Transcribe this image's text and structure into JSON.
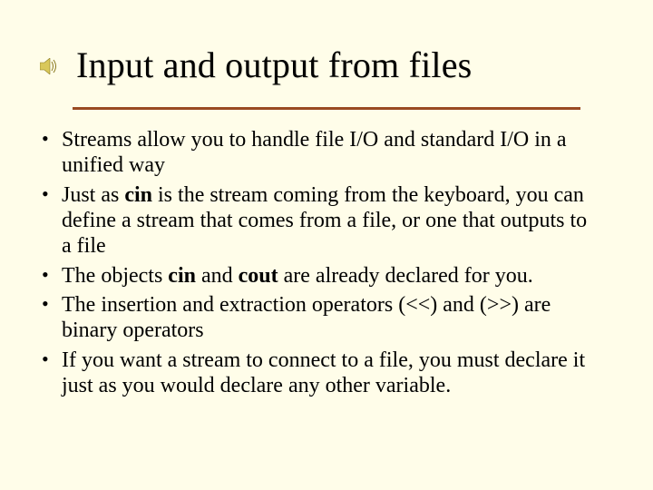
{
  "title": "Input and output from files",
  "icon": "speaker-icon",
  "bullets": [
    {
      "segments": [
        {
          "text": "Streams allow you to handle file I/O and standard I/O in a unified way",
          "bold": false
        }
      ]
    },
    {
      "segments": [
        {
          "text": "Just as ",
          "bold": false
        },
        {
          "text": "cin",
          "bold": true
        },
        {
          "text": " is the stream coming from the keyboard, you can define a stream that comes from a file, or one that outputs to a file",
          "bold": false
        }
      ]
    },
    {
      "segments": [
        {
          "text": "The objects ",
          "bold": false
        },
        {
          "text": "cin",
          "bold": true
        },
        {
          "text": " and ",
          "bold": false
        },
        {
          "text": "cout",
          "bold": true
        },
        {
          "text": " are already declared for you.",
          "bold": false
        }
      ]
    },
    {
      "segments": [
        {
          "text": "The insertion and extraction operators (<<) and (>>) are binary operators",
          "bold": false
        }
      ]
    },
    {
      "segments": [
        {
          "text": " If you want a stream to connect to a file, you must declare it just as you would declare any other variable.",
          "bold": false
        }
      ]
    }
  ],
  "colors": {
    "background": "#fffde9",
    "rule": "#9a4a22",
    "text": "#000000"
  }
}
